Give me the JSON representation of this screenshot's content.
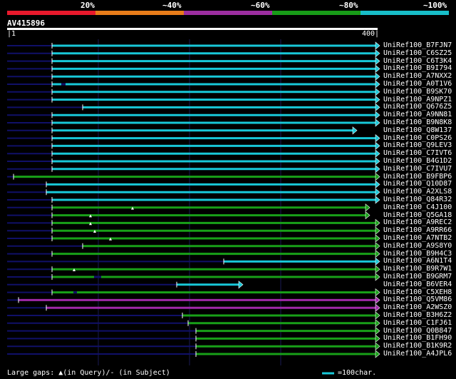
{
  "header": {
    "identity_labels": [
      "20%",
      "~40%",
      "~60%",
      "~80%",
      "~100%"
    ],
    "identity_colors": [
      "#e8192c",
      "#e87c1a",
      "#9c2ea0",
      "#189c18",
      "#18bec8"
    ]
  },
  "query": {
    "name": "AV415896",
    "scale_start": "|1",
    "scale_end": "400|"
  },
  "colors": {
    "cyan": "#18c8d8",
    "green": "#18a018",
    "purple": "#a028a8",
    "navy": "#101068"
  },
  "hits": [
    {
      "label": "UniRef100_B7FJN7",
      "color": "cyan"
    },
    {
      "label": "UniRef100_C6SZ25",
      "color": "cyan"
    },
    {
      "label": "UniRef100_C6T3K4",
      "color": "cyan"
    },
    {
      "label": "UniRef100_B9I794",
      "color": "cyan"
    },
    {
      "label": "UniRef100_A7NXX2",
      "color": "cyan"
    },
    {
      "label": "UniRef100_A0T1V6",
      "color": "cyan"
    },
    {
      "label": "UniRef100_B9SK70",
      "color": "cyan"
    },
    {
      "label": "UniRef100_A9NPZ1",
      "color": "cyan"
    },
    {
      "label": "UniRef100_Q676Z5",
      "color": "cyan"
    },
    {
      "label": "UniRef100_A9NN81",
      "color": "cyan"
    },
    {
      "label": "UniRef100_B9N8K8",
      "color": "cyan"
    },
    {
      "label": "UniRef100_Q8W137",
      "color": "cyan"
    },
    {
      "label": "UniRef100_C0PS26",
      "color": "cyan"
    },
    {
      "label": "UniRef100_Q9LEV3",
      "color": "cyan"
    },
    {
      "label": "UniRef100_C7IVT6",
      "color": "cyan"
    },
    {
      "label": "UniRef100_B4G1D2",
      "color": "cyan"
    },
    {
      "label": "UniRef100_C7IVU7",
      "color": "cyan"
    },
    {
      "label": "UniRef100_B9FBP6",
      "color": "green"
    },
    {
      "label": "UniRef100_Q10D87",
      "color": "cyan"
    },
    {
      "label": "UniRef100_A2XLS8",
      "color": "cyan"
    },
    {
      "label": "UniRef100_Q84R32",
      "color": "cyan"
    },
    {
      "label": "UniRef100_C4J100",
      "color": "green"
    },
    {
      "label": "UniRef100_Q5GA18",
      "color": "green"
    },
    {
      "label": "UniRef100_A9REC2",
      "color": "green"
    },
    {
      "label": "UniRef100_A9RR66",
      "color": "green"
    },
    {
      "label": "UniRef100_A7NTB2",
      "color": "green"
    },
    {
      "label": "UniRef100_A9S8Y0",
      "color": "green"
    },
    {
      "label": "UniRef100_B9H4C3",
      "color": "green"
    },
    {
      "label": "UniRef100_A6N1T4",
      "color": "cyan"
    },
    {
      "label": "UniRef100_B9R7W1",
      "color": "green"
    },
    {
      "label": "UniRef100_B9GRM7",
      "color": "green"
    },
    {
      "label": "UniRef100_B6VER4",
      "color": "cyan"
    },
    {
      "label": "UniRef100_C5XEH8",
      "color": "green"
    },
    {
      "label": "UniRef100_Q5VM86",
      "color": "purple"
    },
    {
      "label": "UniRef100_A2WSZ0",
      "color": "purple"
    },
    {
      "label": "UniRef100_B3H6Z2",
      "color": "green"
    },
    {
      "label": "UniRef100_C1FJ61",
      "color": "green"
    },
    {
      "label": "UniRef100_Q0B847",
      "color": "green"
    },
    {
      "label": "UniRef100_B1FH90",
      "color": "green"
    },
    {
      "label": "UniRef100_B1K9R2",
      "color": "green"
    },
    {
      "label": "UniRef100_A4JPL6",
      "color": "green"
    }
  ],
  "footer": {
    "gaps_legend": "Large gaps: ▲(in Query)/- (in Subject)",
    "scale_legend": "=100char."
  }
}
